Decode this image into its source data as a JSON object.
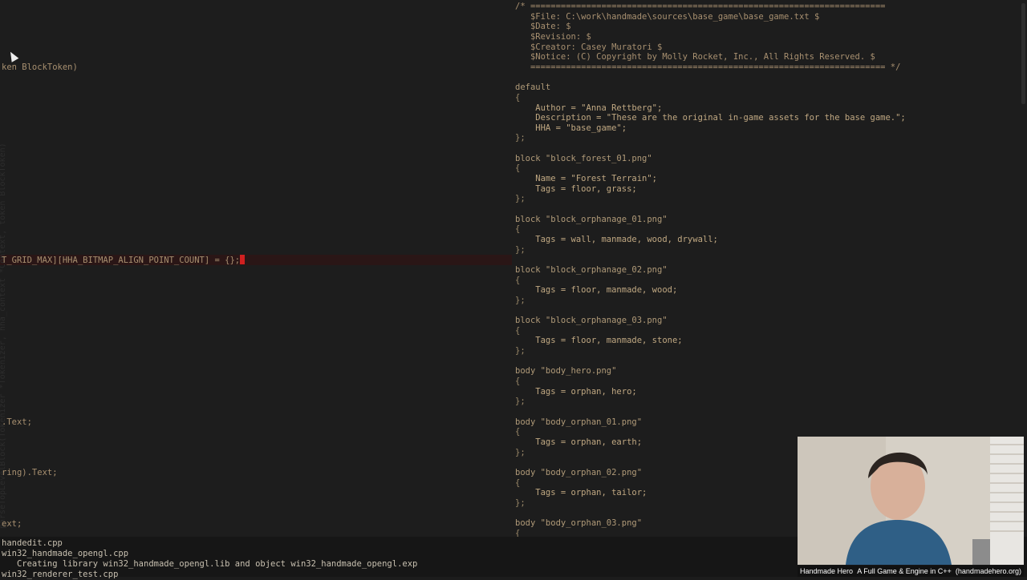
{
  "left_editor": {
    "lines": [
      {
        "text": "ken BlockToken)"
      },
      {
        "text": "T_GRID_MAX][HHA_BITMAP_ALIGN_POINT_COUNT] = {};"
      },
      {
        "text": ".Text;"
      },
      {
        "text": "ring).Text;"
      },
      {
        "text": "ext;"
      }
    ],
    "ghost_text": "parseTopLevelBlock(Tokenizer *Tokenizer, hha_context *Context, token BlockToken)"
  },
  "right_editor": {
    "header": [
      "/* ======================================================================",
      "   $File: C:\\work\\handmade\\sources\\base_game\\base_game.txt $",
      "   $Date: $",
      "   $Revision: $",
      "   $Creator: Casey Muratori $",
      "   $Notice: (C) Copyright by Molly Rocket, Inc., All Rights Reserved. $",
      "   ====================================================================== */"
    ],
    "blocks": [
      {
        "head": "default",
        "body": [
          "    Author = \"Anna Rettberg\";",
          "    Description = \"These are the original in-game assets for the base game.\";",
          "    HHA = \"base_game\";"
        ]
      },
      {
        "head": "block \"block_forest_01.png\"",
        "body": [
          "    Name = \"Forest Terrain\";",
          "    Tags = floor, grass;"
        ]
      },
      {
        "head": "block \"block_orphanage_01.png\"",
        "body": [
          "    Tags = wall, manmade, wood, drywall;"
        ]
      },
      {
        "head": "block \"block_orphanage_02.png\"",
        "body": [
          "    Tags = floor, manmade, wood;"
        ]
      },
      {
        "head": "block \"block_orphanage_03.png\"",
        "body": [
          "    Tags = floor, manmade, stone;"
        ]
      },
      {
        "head": "body \"body_hero.png\"",
        "body": [
          "    Tags = orphan, hero;"
        ]
      },
      {
        "head": "body \"body_orphan_01.png\"",
        "body": [
          "    Tags = orphan, earth;"
        ]
      },
      {
        "head": "body \"body_orphan_02.png\"",
        "body": [
          "    Tags = orphan, tailor;"
        ]
      },
      {
        "head": "body \"body_orphan_03.png\"",
        "body": []
      }
    ],
    "open_brace": "{",
    "close_brace": "};"
  },
  "status": {
    "lines": [
      "handedit.cpp",
      "win32_handmade_opengl.cpp",
      "   Creating library win32_handmade_opengl.lib and object win32_handmade_opengl.exp",
      "win32_renderer_test.cpp"
    ]
  },
  "webcam": {
    "caption_left": "Handmade Hero",
    "caption_mid": "A Full Game & Engine in C++",
    "caption_right": "(handmadehero.org)"
  }
}
